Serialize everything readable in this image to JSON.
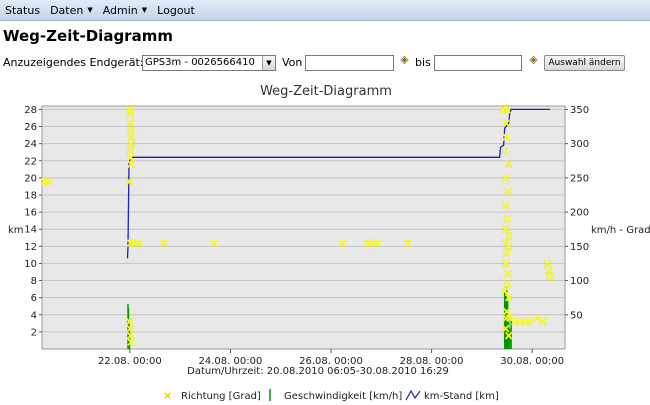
{
  "menu": {
    "items": [
      {
        "label": "Status",
        "has_dropdown": false
      },
      {
        "label": "Daten",
        "has_dropdown": true
      },
      {
        "label": "Admin",
        "has_dropdown": true
      },
      {
        "label": "Logout",
        "has_dropdown": false
      }
    ]
  },
  "page": {
    "title": "Weg-Zeit-Diagramm"
  },
  "filter": {
    "device_label": "Anzuzeigendes Endgerät:",
    "device_value": "GPS3m - 0026566410",
    "from_label": "Von",
    "from_value": "",
    "to_label": "bis",
    "to_value": "",
    "submit_label": "Auswahl ändern",
    "calendar_icon": "calendar-icon"
  },
  "colors": {
    "menubar": "#c4d4ea",
    "plot_background": "#e8e8e8",
    "richtung": "#ffff33",
    "geschwindigkeit": "#009900",
    "km_stand": "#1f1fbf"
  },
  "chart_data": {
    "type": "line",
    "title": "Weg-Zeit-Diagramm",
    "xlabel": "Datum/Uhrzeit: 20.08.2010 06:05-30.08.2010 16:29",
    "ylabel_left": "km",
    "ylabel_right": "km/h - Grad",
    "x_range": [
      "2010-08-20 06:05",
      "2010-08-30 16:29"
    ],
    "x_ticks": [
      "22.08. 00:00",
      "24.08. 00:00",
      "26.08. 00:00",
      "28.08. 00:00",
      "30.08. 00:00"
    ],
    "x_tick_days": [
      1.747,
      3.747,
      5.747,
      7.747,
      9.747
    ],
    "y_left": {
      "ticks": [
        2,
        4,
        6,
        8,
        10,
        12,
        14,
        16,
        18,
        20,
        22,
        24,
        26,
        28
      ],
      "ylim": [
        0,
        28.4
      ]
    },
    "y_right": {
      "ticks": [
        50,
        100,
        150,
        200,
        250,
        300,
        350
      ],
      "ylim": [
        0,
        355
      ]
    },
    "grid": true,
    "legend_position": "bottom",
    "series": [
      {
        "name": "Richtung [Grad]",
        "axis": "right",
        "marker": "x",
        "points": [
          [
            0.05,
            245
          ],
          [
            0.12,
            245
          ],
          [
            1.75,
            350
          ],
          [
            1.75,
            345
          ],
          [
            1.76,
            330
          ],
          [
            1.76,
            320
          ],
          [
            1.77,
            310
          ],
          [
            1.77,
            300
          ],
          [
            1.75,
            290
          ],
          [
            1.76,
            280
          ],
          [
            1.77,
            270
          ],
          [
            1.74,
            245
          ],
          [
            1.76,
            155
          ],
          [
            1.82,
            155
          ],
          [
            1.92,
            155
          ],
          [
            2.42,
            155
          ],
          [
            3.42,
            155
          ],
          [
            5.97,
            155
          ],
          [
            6.47,
            155
          ],
          [
            6.57,
            155
          ],
          [
            6.67,
            155
          ],
          [
            7.27,
            155
          ],
          [
            1.74,
            40
          ],
          [
            1.75,
            30
          ],
          [
            1.76,
            20
          ],
          [
            1.77,
            10
          ],
          [
            9.17,
            350
          ],
          [
            9.25,
            350
          ],
          [
            9.23,
            330
          ],
          [
            9.23,
            310
          ],
          [
            9.2,
            290
          ],
          [
            9.28,
            270
          ],
          [
            9.22,
            250
          ],
          [
            9.26,
            230
          ],
          [
            9.22,
            210
          ],
          [
            9.25,
            190
          ],
          [
            9.22,
            175
          ],
          [
            9.28,
            165
          ],
          [
            9.22,
            155
          ],
          [
            9.28,
            150
          ],
          [
            9.24,
            140
          ],
          [
            9.22,
            125
          ],
          [
            9.26,
            110
          ],
          [
            9.25,
            95
          ],
          [
            9.2,
            85
          ],
          [
            9.28,
            75
          ],
          [
            9.24,
            55
          ],
          [
            9.23,
            45
          ],
          [
            9.3,
            45
          ],
          [
            9.22,
            30
          ],
          [
            9.28,
            20
          ],
          [
            9.4,
            40
          ],
          [
            9.5,
            40
          ],
          [
            9.6,
            40
          ],
          [
            9.7,
            40
          ],
          [
            9.85,
            45
          ],
          [
            9.97,
            40
          ],
          [
            10.05,
            125
          ],
          [
            10.08,
            115
          ],
          [
            10.1,
            105
          ]
        ]
      },
      {
        "name": "Geschwindigkeit [km/h]",
        "axis": "right",
        "marker": "bar",
        "points": [
          [
            1.71,
            66
          ],
          [
            1.72,
            60
          ],
          [
            1.73,
            40
          ],
          [
            1.74,
            25
          ],
          [
            9.2,
            85
          ],
          [
            9.22,
            80
          ],
          [
            9.24,
            90
          ],
          [
            9.26,
            70
          ],
          [
            9.28,
            50
          ],
          [
            9.3,
            30
          ],
          [
            9.33,
            45
          ]
        ]
      },
      {
        "name": "km-Stand [km]",
        "axis": "left",
        "marker": "line",
        "points": [
          [
            1.7,
            10.6
          ],
          [
            1.71,
            12.0
          ],
          [
            1.73,
            21.8
          ],
          [
            1.76,
            22.4
          ],
          [
            9.1,
            22.4
          ],
          [
            9.12,
            23.6
          ],
          [
            9.18,
            23.8
          ],
          [
            9.2,
            25.8
          ],
          [
            9.28,
            26.4
          ],
          [
            9.3,
            27.5
          ],
          [
            9.33,
            28.0
          ],
          [
            10.1,
            28.0
          ]
        ]
      }
    ]
  }
}
